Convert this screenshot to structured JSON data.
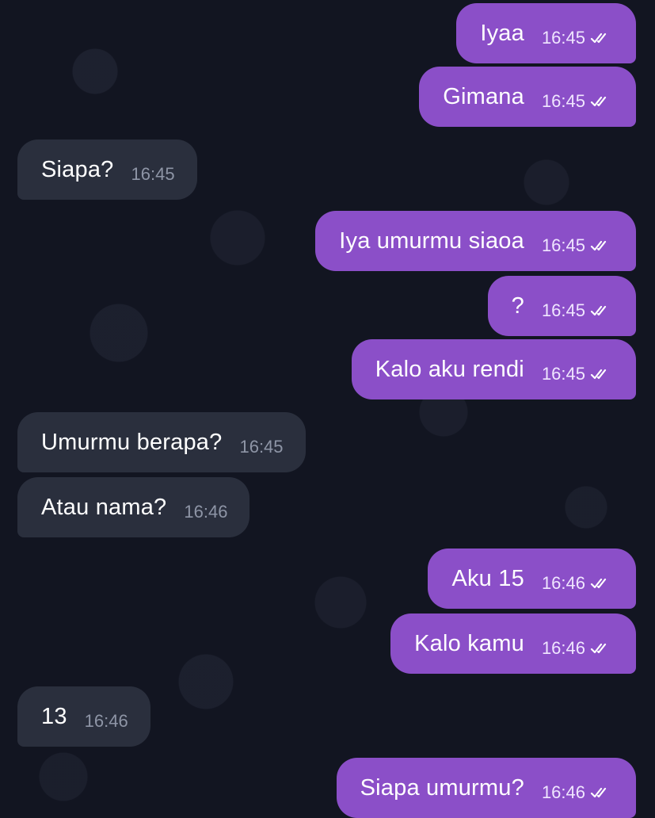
{
  "messages": [
    {
      "direction": "out",
      "text": "Iyaa",
      "time": "16:45",
      "read": true
    },
    {
      "direction": "out",
      "text": "Gimana",
      "time": "16:45",
      "read": true
    },
    {
      "direction": "in",
      "text": "Siapa?",
      "time": "16:45"
    },
    {
      "direction": "out",
      "text": "Iya umurmu siaoa",
      "time": "16:45",
      "read": true
    },
    {
      "direction": "out",
      "text": "?",
      "time": "16:45",
      "read": true
    },
    {
      "direction": "out",
      "text": "Kalo aku rendi",
      "time": "16:45",
      "read": true
    },
    {
      "direction": "in",
      "text": "Umurmu berapa?",
      "time": "16:45"
    },
    {
      "direction": "in",
      "text": "Atau nama?",
      "time": "16:46"
    },
    {
      "direction": "out",
      "text": "Aku 15",
      "time": "16:46",
      "read": true
    },
    {
      "direction": "out",
      "text": "Kalo kamu",
      "time": "16:46",
      "read": true
    },
    {
      "direction": "in",
      "text": "13",
      "time": "16:46"
    },
    {
      "direction": "out",
      "text": "Siapa umurmu?",
      "time": "16:46",
      "read": true
    }
  ],
  "colors": {
    "outgoing_bubble": "#8b4fc8",
    "incoming_bubble": "#2a2f3d",
    "background": "#121521"
  },
  "icons": {
    "read_receipt": "double-check-icon"
  }
}
